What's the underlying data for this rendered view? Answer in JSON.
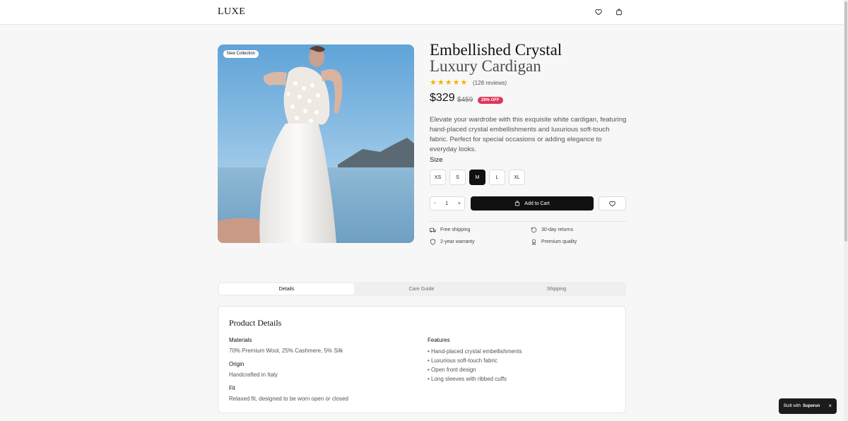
{
  "header": {
    "logo": "LUXE",
    "wishlist_icon": "heart-icon",
    "cart_icon": "shopping-bag-icon"
  },
  "product": {
    "badge": "New Collection",
    "title_line1": "Embellished Crystal",
    "title_line2": "Luxury Cardigan",
    "rating": 5,
    "reviews": "(128 reviews)",
    "price": "$329",
    "old_price": "$459",
    "discount_badge": "28% OFF",
    "description": "Elevate your wardrobe with this exquisite white cardigan, featuring hand-placed crystal embellishments and luxurious soft-touch fabric. Perfect for special occasions or adding elegance to everyday looks.",
    "size_label": "Size",
    "sizes": [
      "XS",
      "S",
      "M",
      "L",
      "XL"
    ],
    "selected_size": "M",
    "quantity": "1",
    "qty_minus": "-",
    "qty_plus": "+",
    "add_to_cart": "Add to Cart"
  },
  "features": [
    {
      "icon": "truck-icon",
      "label": "Free shipping"
    },
    {
      "icon": "rotate-icon",
      "label": "30-day returns"
    },
    {
      "icon": "shield-icon",
      "label": "2-year warranty"
    },
    {
      "icon": "award-icon",
      "label": "Premium quality"
    }
  ],
  "tabs": [
    "Details",
    "Care Guide",
    "Shipping"
  ],
  "active_tab": "Details",
  "details": {
    "title": "Product Details",
    "materials_label": "Materials",
    "materials_value": "70% Premium Wool, 25% Cashmere, 5% Silk",
    "origin_label": "Origin",
    "origin_value": "Handcrafted in Italy",
    "fit_label": "Fit",
    "fit_value": "Relaxed fit, designed to be worn open or closed",
    "features_label": "Features",
    "features": [
      "Hand-placed crystal embellishments",
      "Luxurious soft-touch fabric",
      "Open front design",
      "Long sleeves with ribbed cuffs"
    ]
  },
  "toast": {
    "prefix": "Built with",
    "brand": "Superun",
    "close": "×"
  },
  "colors": {
    "accent": "#111111",
    "discount": "#e0345a",
    "star": "#f5b400"
  }
}
